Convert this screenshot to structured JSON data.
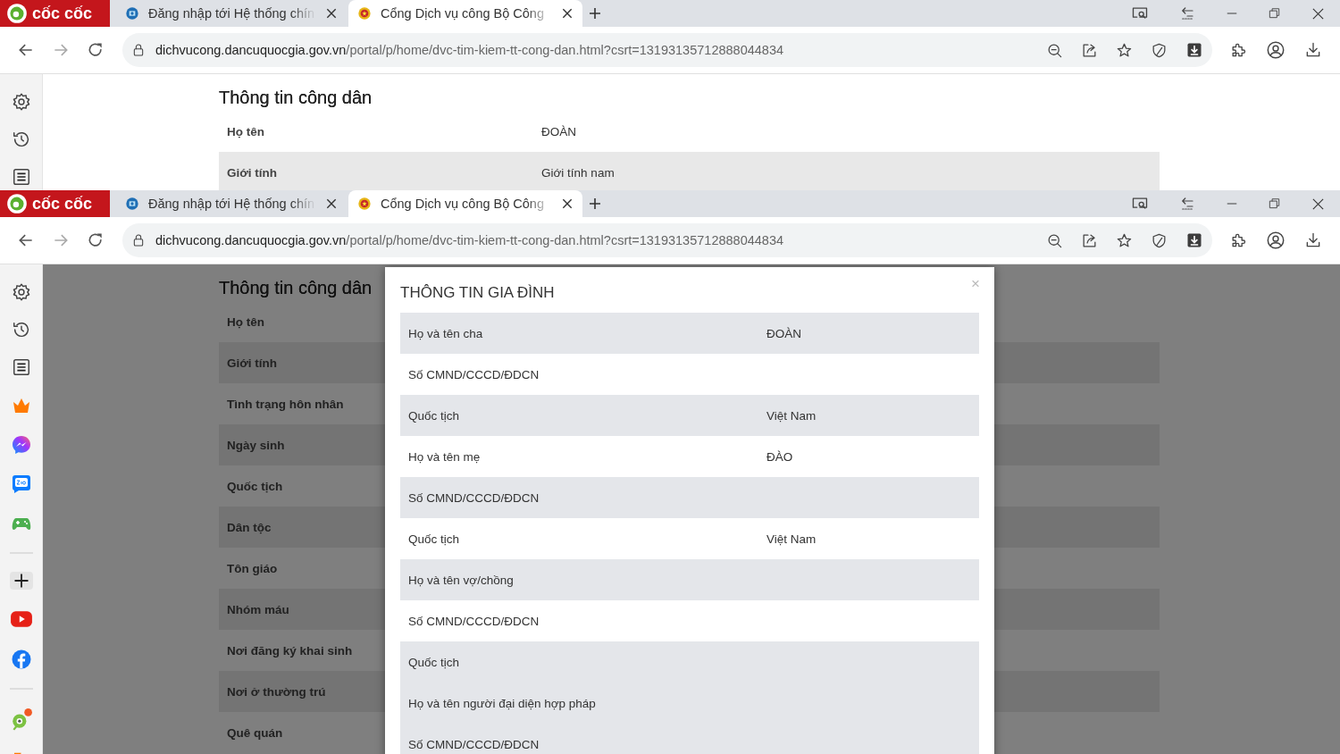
{
  "shots": [
    {
      "logo": "cốc cốc",
      "tabs": [
        {
          "title": "Đăng nhập tới Hệ thống chín",
          "selected": false
        },
        {
          "title": "Cổng Dịch vụ công Bộ Công",
          "selected": true
        }
      ],
      "url_host": "dichvucong.dancuquocgia.gov.vn",
      "url_path": "/portal/p/home/dvc-tim-kiem-tt-cong-dan.html?csrt=13193135712888044834",
      "page": {
        "heading": "Thông tin công dân",
        "rows": [
          {
            "label": "Họ tên",
            "value": "ĐOÀN",
            "shaded": false
          },
          {
            "label": "Giới tính",
            "value": "Giới tính nam",
            "shaded": true
          }
        ]
      }
    },
    {
      "logo": "cốc cốc",
      "tabs": [
        {
          "title": "Đăng nhập tới Hệ thống chín",
          "selected": false
        },
        {
          "title": "Cổng Dịch vụ công Bộ Công",
          "selected": true
        }
      ],
      "url_host": "dichvucong.dancuquocgia.gov.vn",
      "url_path": "/portal/p/home/dvc-tim-kiem-tt-cong-dan.html?csrt=13193135712888044834",
      "page": {
        "heading": "Thông tin công dân",
        "rows": [
          {
            "label": "Họ tên",
            "shaded": false
          },
          {
            "label": "Giới tính",
            "shaded": true
          },
          {
            "label": "Tình trạng hôn nhân",
            "shaded": false
          },
          {
            "label": "Ngày sinh",
            "shaded": true
          },
          {
            "label": "Quốc tịch",
            "shaded": false
          },
          {
            "label": "Dân tộc",
            "shaded": true
          },
          {
            "label": "Tôn giáo",
            "shaded": false
          },
          {
            "label": "Nhóm máu",
            "shaded": true
          },
          {
            "label": "Nơi đăng ký khai sinh",
            "shaded": false
          },
          {
            "label": "Nơi ở thường trú",
            "shaded": true
          },
          {
            "label": "Quê quán",
            "shaded": false
          }
        ]
      },
      "modal": {
        "title": "THÔNG TIN GIA ĐÌNH",
        "close": "×",
        "rows": [
          {
            "label": "Họ và tên cha",
            "value": "ĐOÀN",
            "shaded": true
          },
          {
            "label": "Số CMND/CCCD/ĐDCN",
            "shaded": false
          },
          {
            "label": "Quốc tịch",
            "value": "Việt Nam",
            "shaded": true
          },
          {
            "label": "Họ và tên mẹ",
            "value": "ĐÀO",
            "shaded": false
          },
          {
            "label": "Số CMND/CCCD/ĐDCN",
            "shaded": true
          },
          {
            "label": "Quốc tịch",
            "value": "Việt Nam",
            "shaded": false
          },
          {
            "label": "Họ và tên vợ/chồng",
            "shaded": true
          },
          {
            "label": "Số CMND/CCCD/ĐDCN",
            "shaded": false
          },
          {
            "label": "Quốc tịch",
            "shaded": true
          },
          {
            "label": "Họ và tên người đại diện hợp pháp",
            "shaded": true
          },
          {
            "label": "Số CMND/CCCD/ĐDCN",
            "shaded": true
          }
        ]
      }
    }
  ]
}
